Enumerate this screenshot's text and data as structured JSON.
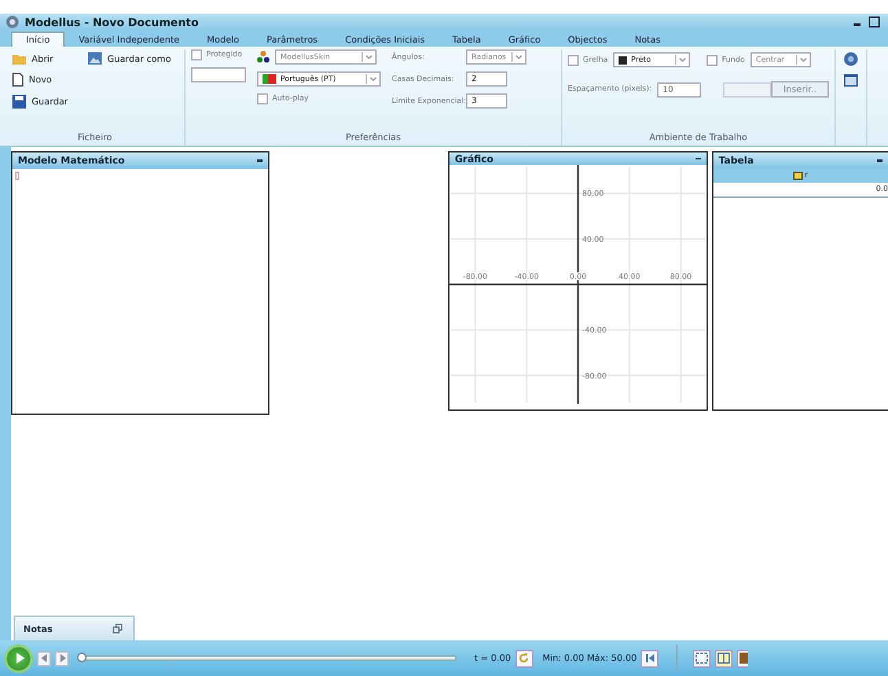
{
  "window": {
    "title": "Modellus - Novo Documento"
  },
  "tabs": [
    {
      "label": "Início",
      "selected": true
    },
    {
      "label": "Variável Independente",
      "selected": false
    },
    {
      "label": "Modelo",
      "selected": false
    },
    {
      "label": "Parâmetros",
      "selected": false
    },
    {
      "label": "Condições Iniciais",
      "selected": false
    },
    {
      "label": "Tabela",
      "selected": false
    },
    {
      "label": "Gráfico",
      "selected": false
    },
    {
      "label": "Objectos",
      "selected": false
    },
    {
      "label": "Notas",
      "selected": false
    }
  ],
  "ficheiro": {
    "label": "Ficheiro",
    "buttons": [
      {
        "label": "Abrir",
        "kind": "open"
      },
      {
        "label": "Guardar como",
        "kind": "saveas"
      },
      {
        "label": "Novo",
        "kind": "new"
      },
      {
        "label": "Guardar",
        "kind": "save"
      }
    ]
  },
  "preferencias": {
    "label": "Preferências",
    "protegido": {
      "label": "Protegido",
      "checked": false
    },
    "skin": "ModellusSkin",
    "language": "Português (PT)",
    "autoplay": {
      "label": "Auto-play",
      "checked": false
    },
    "angles": {
      "label": "Ângulos:",
      "value": "Radianos"
    },
    "decimals": {
      "label": "Casas Decimais:",
      "value": "2"
    },
    "exponent": {
      "label": "Limite Exponencial:",
      "value": "3"
    }
  },
  "ambiente": {
    "label": "Ambiente de Trabalho",
    "grid": {
      "label": "Grelha",
      "checked": false
    },
    "grid_color": "Preto",
    "background": {
      "label": "Fundo",
      "checked": false
    },
    "position": "Centrar",
    "spacing": {
      "label": "Espaçamento (pixels):",
      "value": "10"
    },
    "insert": "Inserir.."
  },
  "model_panel": {
    "title": "Modelo Matemático"
  },
  "graph_panel": {
    "title": "Gráfico",
    "chart_data": {
      "type": "line",
      "grid": true,
      "xlim": [
        -100,
        100
      ],
      "ylim": [
        -105,
        105
      ],
      "xticks": [
        {
          "value": -80,
          "label": "-80.00"
        },
        {
          "value": -40,
          "label": "-40.00"
        },
        {
          "value": 0,
          "label": "0.00"
        },
        {
          "value": 40,
          "label": "40.00"
        },
        {
          "value": 80,
          "label": "80.00"
        }
      ],
      "yticks": [
        {
          "value": 80,
          "label": "80.00"
        },
        {
          "value": 40,
          "label": "40.00"
        },
        {
          "value": -40,
          "label": "-40.00"
        },
        {
          "value": -80,
          "label": "-80.00"
        }
      ]
    }
  },
  "table_panel": {
    "title": "Tabela",
    "column": "r",
    "value": "0.0"
  },
  "notes_tab": {
    "title": "Notas"
  },
  "player": {
    "level": 0,
    "time": "t = 0.00",
    "range": "Min: 0.00 Máx: 50.00"
  }
}
